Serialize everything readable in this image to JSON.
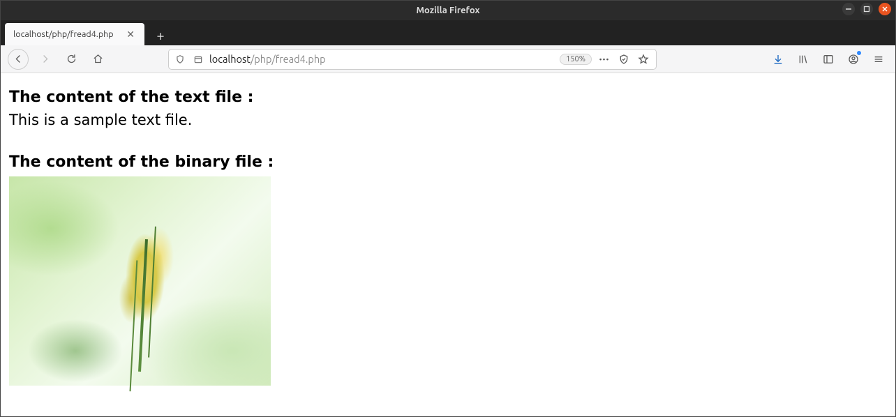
{
  "window": {
    "title": "Mozilla Firefox"
  },
  "tab": {
    "label": "localhost/php/fread4.php"
  },
  "url": {
    "host": "localhost",
    "path": "/php/fread4.php"
  },
  "zoom": {
    "label": "150%"
  },
  "page": {
    "heading1": "The content of the text file :",
    "text1": "This is a sample text file.",
    "heading2": "The content of the binary file :"
  }
}
